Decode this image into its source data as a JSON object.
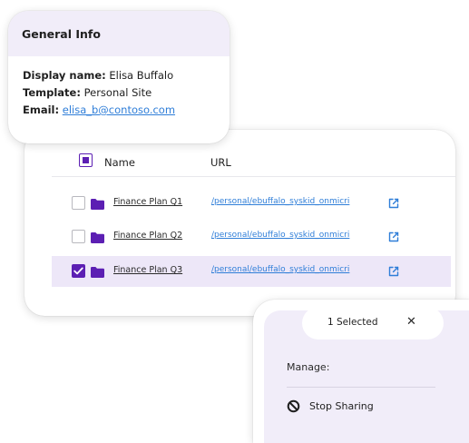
{
  "general_info": {
    "title": "General Info",
    "display_name_label": "Display name:",
    "display_name_value": "Elisa Buffalo",
    "template_label": "Template:",
    "template_value": "Personal Site",
    "email_label": "Email:",
    "email_value": "elisa_b@contoso.com"
  },
  "table": {
    "columns": {
      "name": "Name",
      "url": "URL"
    },
    "rows": [
      {
        "name": "Finance Plan Q1",
        "url": "/personal/ebuffalo_syskid_onmicri",
        "checked": false
      },
      {
        "name": "Finance Plan Q2",
        "url": "/personal/ebuffalo_syskid_onmicri",
        "checked": false
      },
      {
        "name": "Finance Plan Q3",
        "url": "/personal/ebuffalo_syskid_onmicri",
        "checked": true
      }
    ]
  },
  "selection_panel": {
    "count_label": "1 Selected",
    "close_glyph": "✕",
    "manage_label": "Manage:",
    "stop_sharing_label": "Stop Sharing"
  },
  "icons": {
    "folder": "folder-icon",
    "open_external": "open-external-icon",
    "checkmark": "checkmark-icon",
    "close": "close-icon",
    "block": "block-icon"
  },
  "colors": {
    "accent": "#5c1fb3",
    "selected_row": "#ede7f8",
    "panel_tint": "#f1edf9",
    "link": "#2f7ed8"
  }
}
